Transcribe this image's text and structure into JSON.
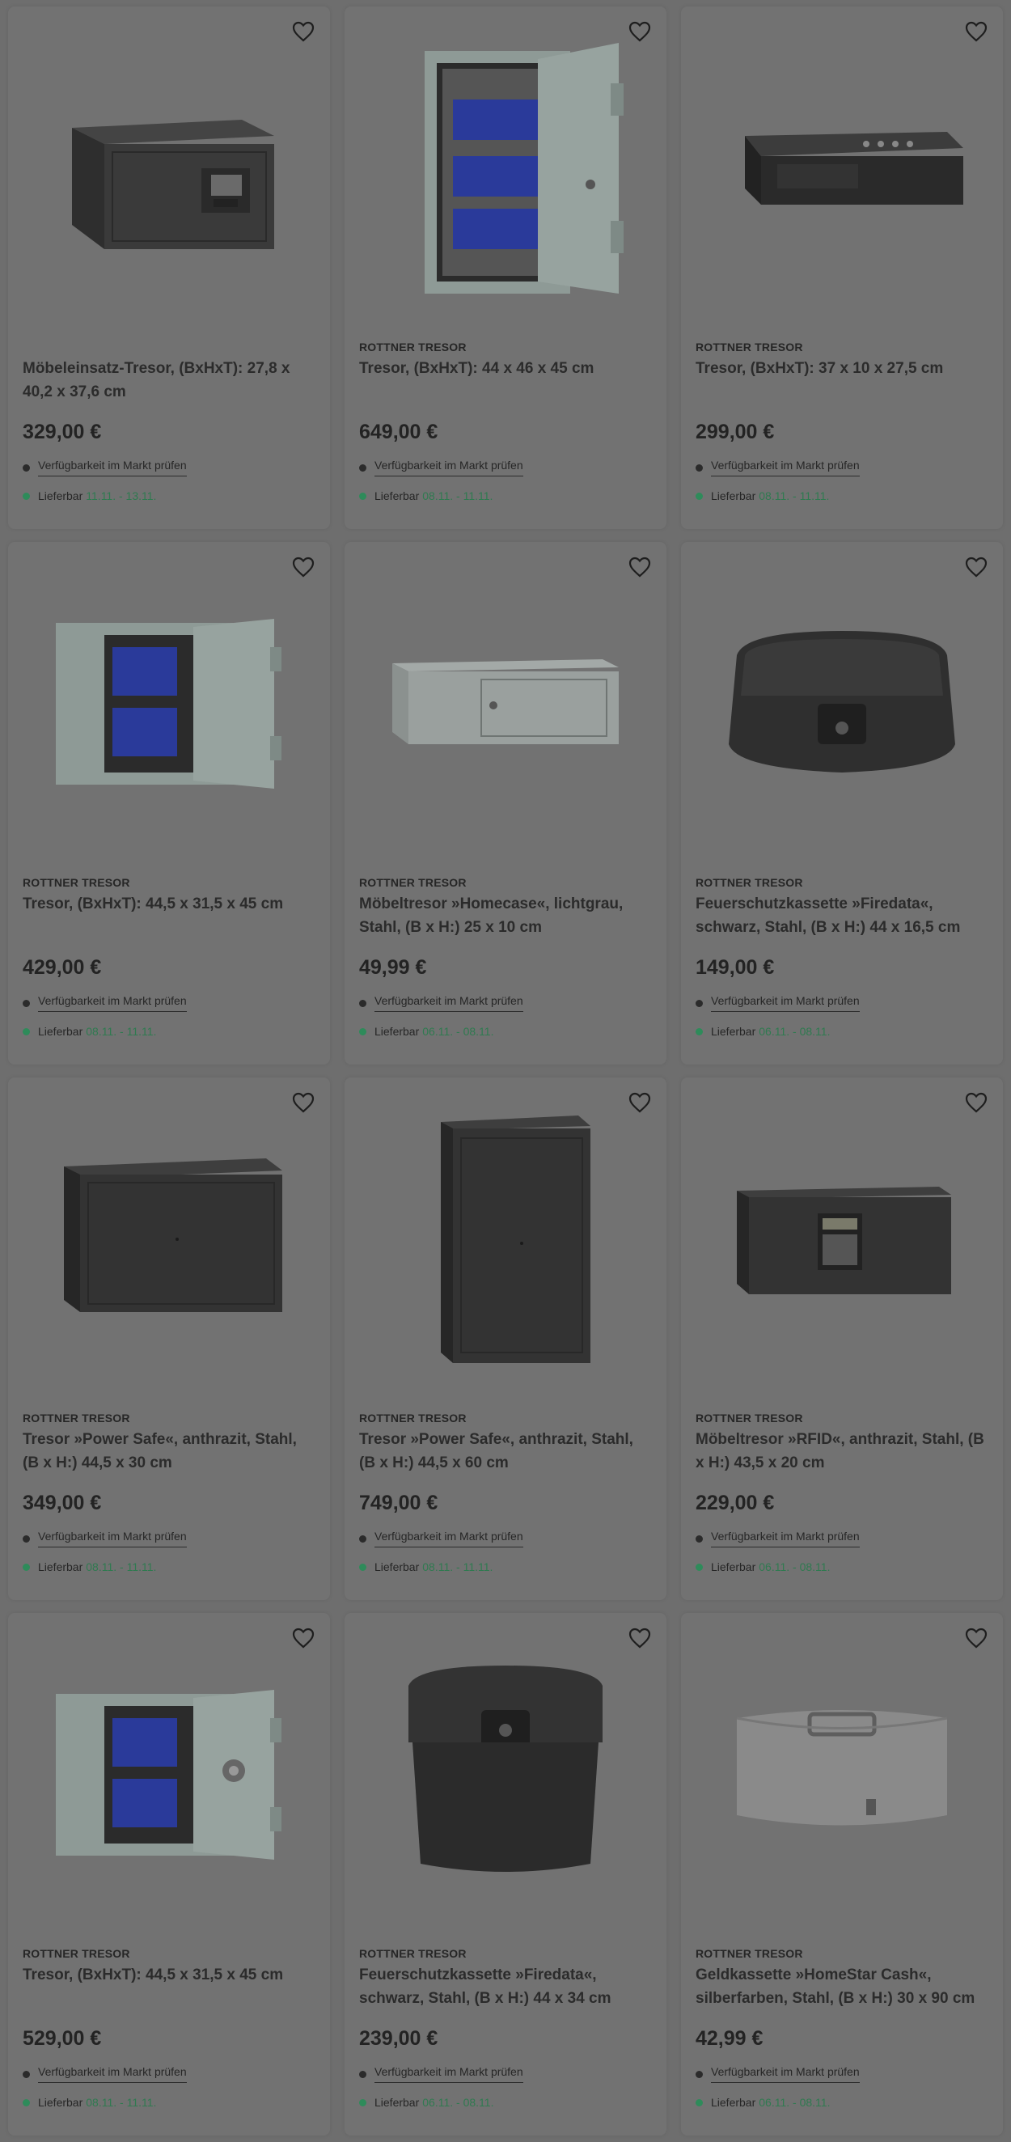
{
  "colors": {
    "overlay_bg": "#6e6e6e",
    "card_bg": "#727272",
    "delivery_green": "#2f7a50"
  },
  "common": {
    "availability_label": "Verfügbarkeit im Markt prüfen",
    "delivery_label": "Lieferbar",
    "favorite_icon": "heart-outline-icon"
  },
  "products": [
    {
      "brand": "",
      "title": "Möbeleinsatz-Tresor, (BxHxT): 27,8 x 40,2 x 37,6 cm",
      "price": "329,00 €",
      "delivery": "11.11. - 13.11.",
      "image": "black-cube-safe-with-keypad"
    },
    {
      "brand": "ROTTNER TRESOR",
      "title": "Tresor, (BxHxT): 44 x 46 x 45 cm",
      "price": "649,00 €",
      "delivery": "08.11. - 11.11.",
      "image": "grey-safe-open-blue-folders"
    },
    {
      "brand": "ROTTNER TRESOR",
      "title": "Tresor, (BxHxT): 37 x 10 x 27,5 cm",
      "price": "299,00 €",
      "delivery": "08.11. - 11.11.",
      "image": "flat-black-gun-safe"
    },
    {
      "brand": "ROTTNER TRESOR",
      "title": "Tresor, (BxHxT): 44,5 x 31,5 x 45 cm",
      "price": "429,00 €",
      "delivery": "08.11. - 11.11.",
      "image": "grey-safe-open-blue-folders-wide"
    },
    {
      "brand": "ROTTNER TRESOR",
      "title": "Möbeltresor »Homecase«, lichtgrau, Stahl, (B x H:) 25 x 10 cm",
      "price": "49,99 €",
      "delivery": "06.11. - 08.11.",
      "image": "light-grey-flat-safe"
    },
    {
      "brand": "ROTTNER TRESOR",
      "title": "Feuerschutzkassette »Firedata«, schwarz, Stahl, (B x H:) 44 x 16,5 cm",
      "price": "149,00 €",
      "delivery": "06.11. - 08.11.",
      "image": "black-fire-case-flat"
    },
    {
      "brand": "ROTTNER TRESOR",
      "title": "Tresor »Power Safe«, anthrazit, Stahl, (B x H:) 44,5 x 30 cm",
      "price": "349,00 €",
      "delivery": "08.11. - 11.11.",
      "image": "anthracite-wide-safe"
    },
    {
      "brand": "ROTTNER TRESOR",
      "title": "Tresor »Power Safe«, anthrazit, Stahl, (B x H:) 44,5 x 60 cm",
      "price": "749,00 €",
      "delivery": "08.11. - 11.11.",
      "image": "anthracite-tall-safe"
    },
    {
      "brand": "ROTTNER TRESOR",
      "title": "Möbeltresor »RFID«, anthrazit, Stahl, (B x H:) 43,5 x 20 cm",
      "price": "229,00 €",
      "delivery": "06.11. - 08.11.",
      "image": "anthracite-keypad-safe"
    },
    {
      "brand": "ROTTNER TRESOR",
      "title": "Tresor, (BxHxT): 44,5 x 31,5 x 45 cm",
      "price": "529,00 €",
      "delivery": "08.11. - 11.11.",
      "image": "grey-safe-open-dial"
    },
    {
      "brand": "ROTTNER TRESOR",
      "title": "Feuerschutzkassette »Firedata«, schwarz, Stahl, (B x H:) 44 x 34 cm",
      "price": "239,00 €",
      "delivery": "06.11. - 08.11.",
      "image": "black-fire-case-tall"
    },
    {
      "brand": "ROTTNER TRESOR",
      "title": "Geldkassette »HomeStar Cash«, silberfarben, Stahl, (B x H:) 30 x 90 cm",
      "price": "42,99 €",
      "delivery": "06.11. - 08.11.",
      "image": "silver-cash-box"
    }
  ]
}
